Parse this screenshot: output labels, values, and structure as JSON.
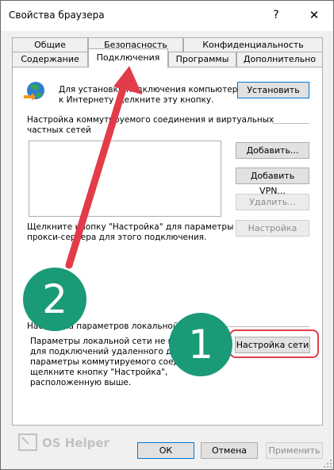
{
  "window": {
    "title": "Свойства браузера",
    "help_glyph": "?",
    "close_glyph": "✕"
  },
  "tabs_row1": [
    "Общие",
    "Безопасность",
    "Конфиденциальность"
  ],
  "tabs_row2": [
    "Содержание",
    "Подключения",
    "Программы",
    "Дополнительно"
  ],
  "active_tab": "Подключения",
  "setup": {
    "text_line1": "Для установки подключения компьютера",
    "text_line2": "к Интернету щелкните эту кнопку.",
    "button": "Установить"
  },
  "dialup": {
    "header_line1": "Настройка коммутируемого соединения и виртуальных",
    "header_line2": "частных сетей",
    "add": "Добавить...",
    "add_vpn": "Добавить VPN...",
    "remove": "Удалить...",
    "settings": "Настройка",
    "proxy_line1": "Щелкните кнопку \"Настройка\" для параметры",
    "proxy_line2": "прокси-сервера для этого подключения."
  },
  "lan": {
    "header": "Настройка параметров локальной сети",
    "desc_line1": "Параметры локальной сети не применяются",
    "desc_line2": "для подключений удаленного доступа. Для",
    "desc_line3": "параметры коммутируемого соединения",
    "desc_line4": "щелкните кнопку \"Настройка\",",
    "desc_line5": "расположенную выше.",
    "button": "Настройка сети"
  },
  "footer": {
    "ok": "ОК",
    "cancel": "Отмена",
    "apply": "Применить"
  },
  "annotations": {
    "step1": "1",
    "step2": "2",
    "color_accent": "#1a9a76",
    "color_arrow": "#e23c4a"
  },
  "watermark": "OS Helper"
}
